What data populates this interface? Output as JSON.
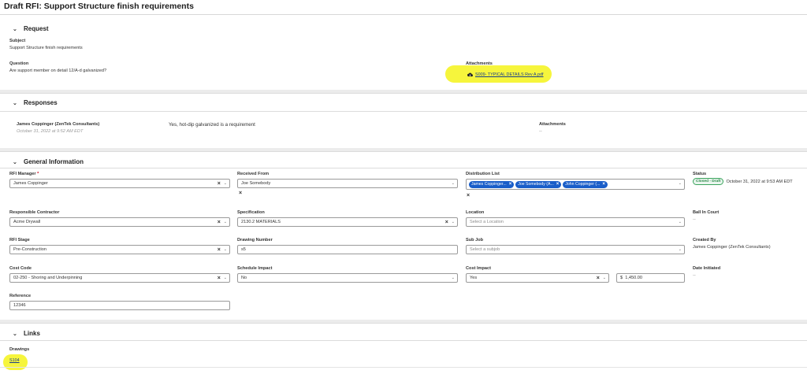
{
  "page": {
    "title": "Draft RFI: Support Structure finish requirements"
  },
  "request": {
    "heading": "Request",
    "subject_label": "Subject",
    "subject_value": "Support Structure finish requirements",
    "question_label": "Question",
    "question_value": "Are support member on detail 12/A-d galvanized?",
    "attachments_label": "Attachments",
    "attachment_file": "S009- TYPICAL DETAILS Rev A.pdf"
  },
  "responses": {
    "heading": "Responses",
    "author": "James Coppinger (ZenTek Consultants)",
    "timestamp": "October 31, 2022 at 9:52 AM EDT",
    "text": "Yes, hot-dip galvanized is a requirement",
    "attachments_label": "Attachments",
    "attachments_value": "--"
  },
  "general": {
    "heading": "General Information",
    "rfi_manager_label": "RFI Manager",
    "required_mark": "*",
    "rfi_manager_value": "James Coppinger",
    "received_from_label": "Received From",
    "received_from_value": "Joe Somebody",
    "distribution_label": "Distribution List",
    "distribution": [
      "James Coppinger...",
      "Joe Somebody (A...",
      "John Coppinger (..."
    ],
    "status_label": "Status",
    "status_badge": "Closed - Draft",
    "status_date": "October 31, 2022 at 9:53 AM EDT",
    "responsible_label": "Responsible Contractor",
    "responsible_value": "Acme Drywall",
    "spec_label": "Specification",
    "spec_value": "2130.2 MATERIALS",
    "location_label": "Location",
    "location_placeholder": "Select a Location",
    "ball_label": "Ball In Court",
    "ball_value": "--",
    "stage_label": "RFI Stage",
    "stage_value": "Pre-Construction",
    "drawing_label": "Drawing Number",
    "drawing_value": "s5",
    "subjob_label": "Sub Job",
    "subjob_placeholder": "Select a subjob",
    "created_label": "Created By",
    "created_value": "James Coppinger (ZenTek Consultants)",
    "cost_code_label": "Cost Code",
    "cost_code_value": "02-250 - Shoring and Underpinning",
    "schedule_label": "Schedule Impact",
    "schedule_value": "No",
    "cost_impact_label": "Cost Impact",
    "cost_impact_value": "Yes",
    "cost_amount": "$  1,450.00",
    "date_init_label": "Date Initiated",
    "date_init_value": "--",
    "reference_label": "Reference",
    "reference_value": "12346"
  },
  "links": {
    "heading": "Links",
    "drawings_label": "Drawings",
    "drawing_link": "S104"
  },
  "colors": {
    "pill": "#1a5ec9",
    "highlight": "#f6f53c",
    "status_green": "#3aa35c"
  }
}
